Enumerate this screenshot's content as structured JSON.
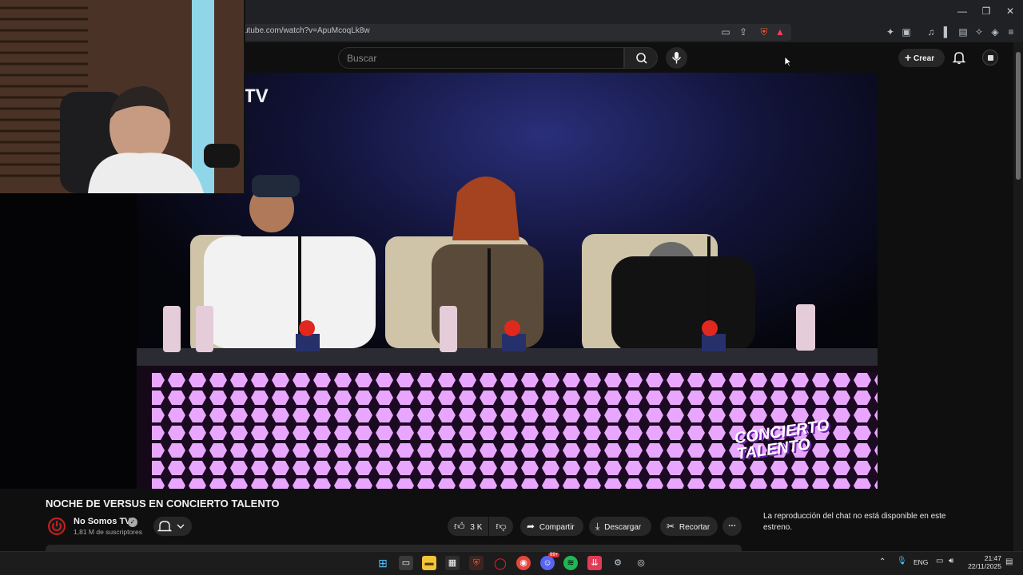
{
  "browser": {
    "url": "utube.com/watch?v=ApuMcoqLk8w",
    "window_controls": [
      "—",
      "❐",
      "✕"
    ]
  },
  "header": {
    "search_placeholder": "Buscar",
    "create_label": "Crear"
  },
  "video": {
    "channel_watermark": "TV",
    "show_logo_line1": "CONCIERTO",
    "show_logo_line2": "TALENTO",
    "title": "NOCHE DE VERSUS EN CONCIERTO TALENTO"
  },
  "channel": {
    "name": "No Somos TV",
    "subscribers": "1,81 M de suscriptores"
  },
  "actions": {
    "likes": "3 K",
    "share": "Compartir",
    "download": "Descargar",
    "clip": "Recortar"
  },
  "chat": {
    "message": "La reproducción del chat no está disponible en este estreno."
  },
  "taskbar": {
    "language": "ENG",
    "time": "21:47",
    "date": "22/11/2025",
    "discord_badge": "99+"
  },
  "colors": {
    "background": "#0f0f0f",
    "desk_glow": "#e9a6ff",
    "accent_red": "#c62020"
  }
}
